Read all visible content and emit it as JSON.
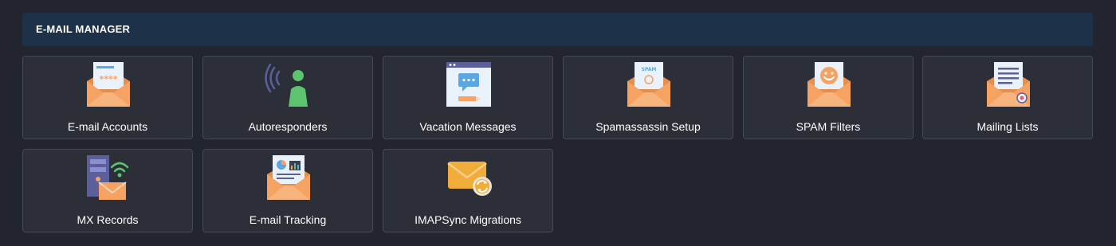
{
  "panel": {
    "title": "E-MAIL MANAGER"
  },
  "tiles": [
    {
      "label": "E-mail Accounts",
      "icon": "email-accounts-icon"
    },
    {
      "label": "Autoresponders",
      "icon": "autoresponder-icon"
    },
    {
      "label": "Vacation Messages",
      "icon": "vacation-message-icon"
    },
    {
      "label": "Spamassassin Setup",
      "icon": "spamassassin-icon"
    },
    {
      "label": "SPAM Filters",
      "icon": "spam-filter-icon"
    },
    {
      "label": "Mailing Lists",
      "icon": "mailing-list-icon"
    },
    {
      "label": "MX Records",
      "icon": "mx-records-icon"
    },
    {
      "label": "E-mail Tracking",
      "icon": "email-tracking-icon"
    },
    {
      "label": "IMAPSync Migrations",
      "icon": "imapsync-icon"
    }
  ],
  "colors": {
    "background": "#22252d",
    "header": "#1d3149",
    "tile": "#2c2f38",
    "tile_border": "#464a55",
    "envelope": "#f5a263",
    "envelope_flap": "#f7b57d",
    "letter": "#e9f1fb",
    "accent_blue": "#5da7e0"
  }
}
